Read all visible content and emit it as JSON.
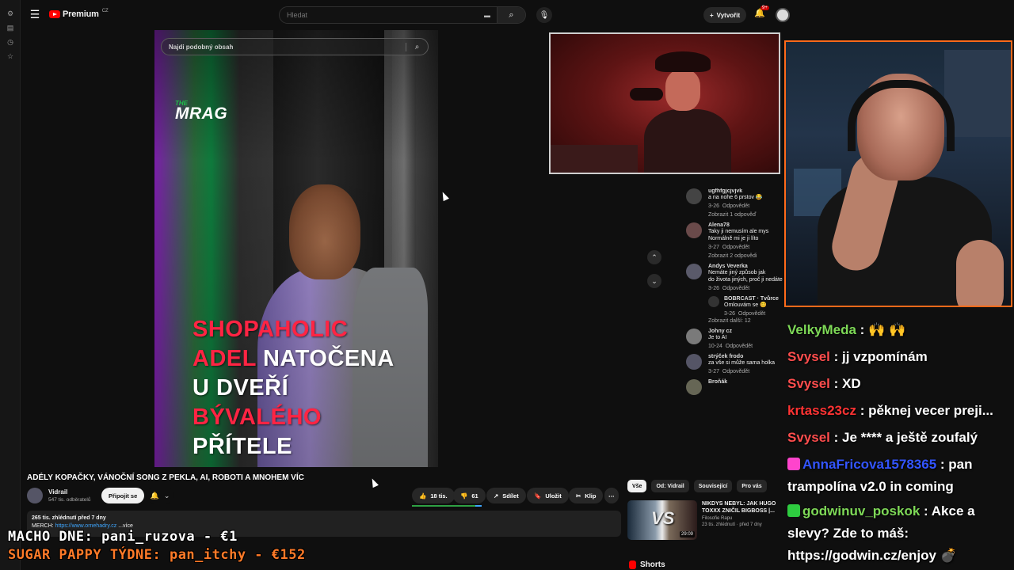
{
  "topbar": {
    "logo_text": "Premium",
    "logo_country": "CZ",
    "search_placeholder": "Hledat",
    "create_label": "Vytvořit",
    "notif_count": "9+"
  },
  "video": {
    "search_placeholder": "Najdi podobný obsah",
    "brand_small": "THE",
    "brand_main": "MRAG",
    "headline": [
      {
        "text": "SHOPAHOLIC",
        "color": "red"
      },
      {
        "text": "ADEL",
        "color": "red"
      },
      {
        "text": "NATOČENA",
        "color": "white"
      },
      {
        "text": "U DVEŘÍ",
        "color": "white"
      },
      {
        "text": "BÝVALÉHO",
        "color": "red"
      },
      {
        "text": "PŘÍTELE",
        "color": "white"
      }
    ]
  },
  "comments": [
    {
      "author": "ugfhfgjcjvjvk",
      "text": "a na nohe 6 prstov 😂",
      "date": "3-26",
      "reply": "Odpovědět",
      "replies": "Zobrazit 1 odpověď"
    },
    {
      "author": "Alena78",
      "text": "Taky ji nemusím ale mys",
      "text2": "Normálně mi je ji líto",
      "date": "3-27",
      "reply": "Odpovědět",
      "replies": "Zobrazit 2 odpovědi"
    },
    {
      "author": "Andys Veverka",
      "text": "Nemáte jiný způsob jak",
      "text2": "do života jiných, proč ji nedáte",
      "date": "3-26",
      "reply": "Odpovědět"
    },
    {
      "author": "BOBRCAST · Tvůrce",
      "text": "Omlouvám se 😊",
      "date": "3-26",
      "reply": "Odpovědět",
      "replies": "Zobrazit další: 12",
      "sub": true
    },
    {
      "author": "Johny cz",
      "text": "Je to AI",
      "date": "10-24",
      "reply": "Odpovědět"
    },
    {
      "author": "strýček frodo",
      "text": "za vše si může sama holka",
      "date": "3-27",
      "reply": "Odpovědět"
    },
    {
      "author": "Broňák",
      "text": ""
    }
  ],
  "info": {
    "title": "ADÉLY KOPAČKY, VÁNOČNÍ SONG Z PEKLA, AI, ROBOTI A MNOHEM VÍC",
    "channel": "Vidrail",
    "subs": "547 tis. odběratelů",
    "join": "Připojit se",
    "likes": "18 tis.",
    "dislikes": "61",
    "share": "Sdílet",
    "save": "Uložit",
    "clip": "Klip",
    "desc_views": "265 tis. zhlédnutí  před 7 dny",
    "desc_prefix": "MERCH: ",
    "desc_link": "https://www.ornehadry.cz",
    "desc_more": "...více"
  },
  "filters": [
    "Vše",
    "Od: Vidrail",
    "Související",
    "Pro vás"
  ],
  "rec": {
    "title": "NIKDYS NEBYL: JAK HUGO TOXXX ZNIČIL BIGBOSS |...",
    "channel": "Filosofie Rapu",
    "meta": "23 tis. zhlédnutí · před 7 dny",
    "duration": "29:09",
    "vs": "VS"
  },
  "shorts_label": "Shorts",
  "overlay": {
    "line1": "MACHO DNE: pani_ruzova - €1",
    "line2": "SUGAR PAPPY TÝDNE: pan_itchy - €152"
  },
  "chat": [
    {
      "user": "VelkyMeda",
      "msg": " : 🙌 🙌",
      "color": "#7ed957"
    },
    {
      "user": "Svysel",
      "msg": " : jj vzpomínám",
      "color": "#ff4d4d"
    },
    {
      "user": "Svysel",
      "msg": " : XD",
      "color": "#ff4d4d"
    },
    {
      "user": "krtass23cz",
      "msg": " : pěknej vecer preji...",
      "color": "#ff3333"
    },
    {
      "user": "Svysel",
      "msg": " : Je **** a ještě zoufalý",
      "color": "#ff4d4d"
    },
    {
      "user": "AnnaFricova1578365",
      "msg": " : pan trampolína v2.0 in coming",
      "color": "#3355ff"
    },
    {
      "user": "godwinuv_poskok",
      "msg": " : Akce a slevy? Zde to máš: https://godwin.cz/enjoy 💣",
      "color": "#7ed957"
    }
  ],
  "colors": {
    "accent": "#ff0000",
    "link": "#3ea6ff",
    "overlay_orange": "#ff7a28",
    "frame_orange": "#ff6a1a"
  }
}
